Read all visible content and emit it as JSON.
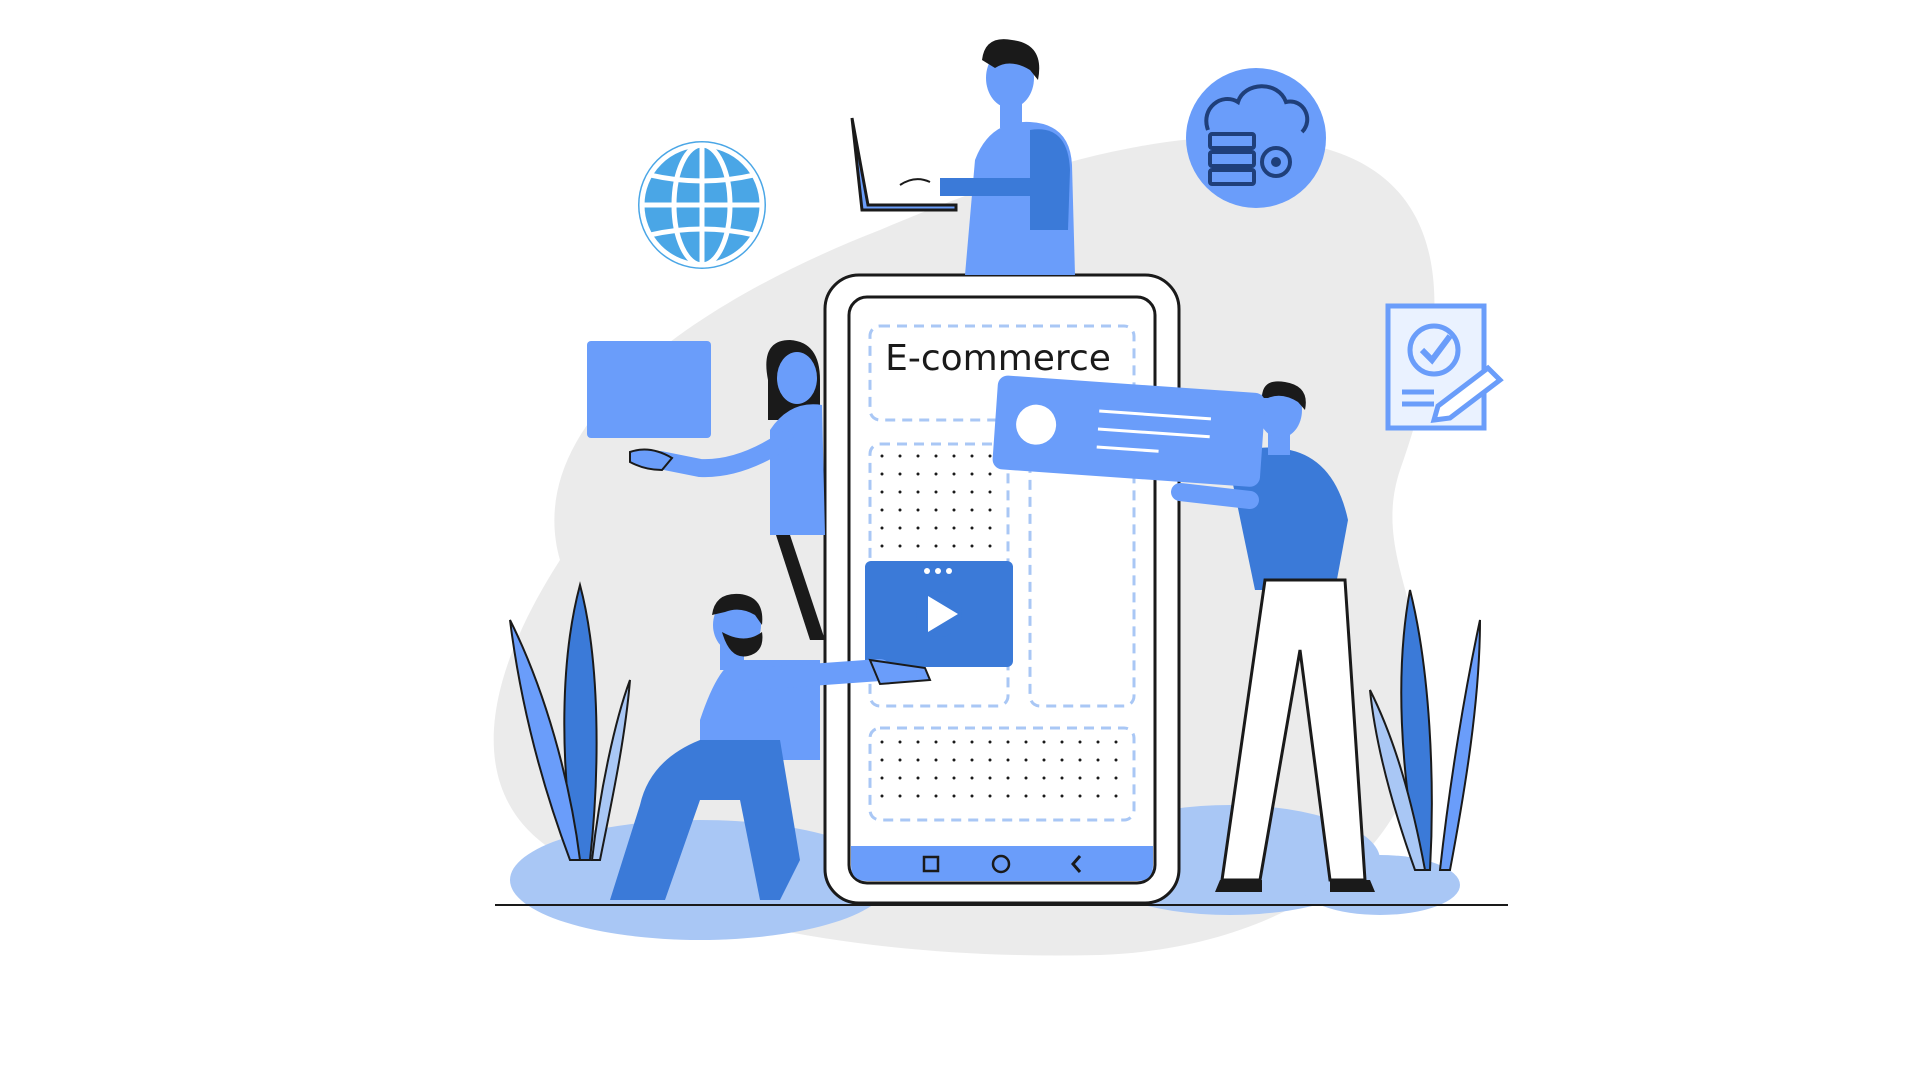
{
  "phone": {
    "title": "E-commerce",
    "nav_buttons": [
      "square-nav-icon",
      "circle-nav-icon",
      "back-chevron-icon"
    ]
  },
  "floating_icons": [
    "globe-icon",
    "cloud-server-settings-icon",
    "checklist-document-icon"
  ],
  "colors": {
    "primary_blue": "#6a9dfa",
    "dark_blue": "#3b7ad8",
    "pale_blue": "#a9c7f5",
    "blob_gray": "#ebebeb",
    "outline": "#1a1a1a",
    "globe_blue": "#4aa6e6"
  }
}
